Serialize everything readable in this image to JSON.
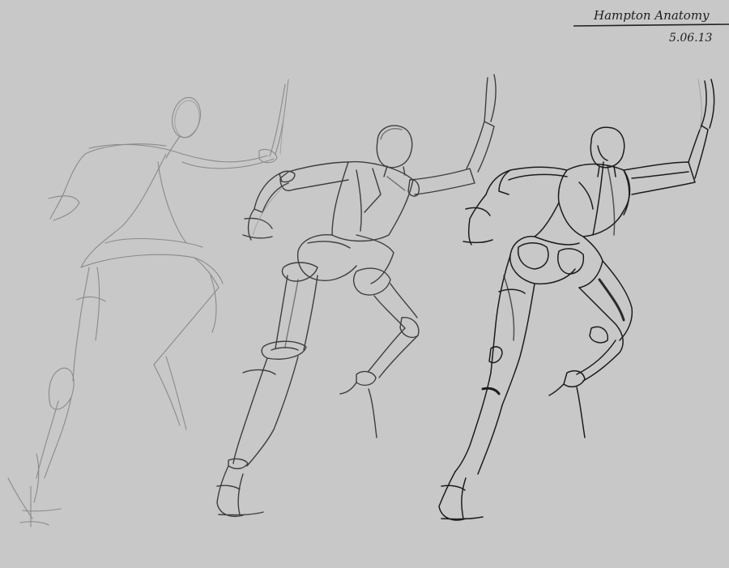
{
  "signature": {
    "name": "Hampton Anatomy",
    "date": "5.06.13"
  },
  "sketches": [
    {
      "stage": "gesture"
    },
    {
      "stage": "mannequin"
    },
    {
      "stage": "anatomy"
    }
  ],
  "colors": {
    "background": "#c8c8c8",
    "light_line": "#8a8a8a",
    "mid_line": "#4a4a4a",
    "dark_line": "#1c1c1c"
  }
}
